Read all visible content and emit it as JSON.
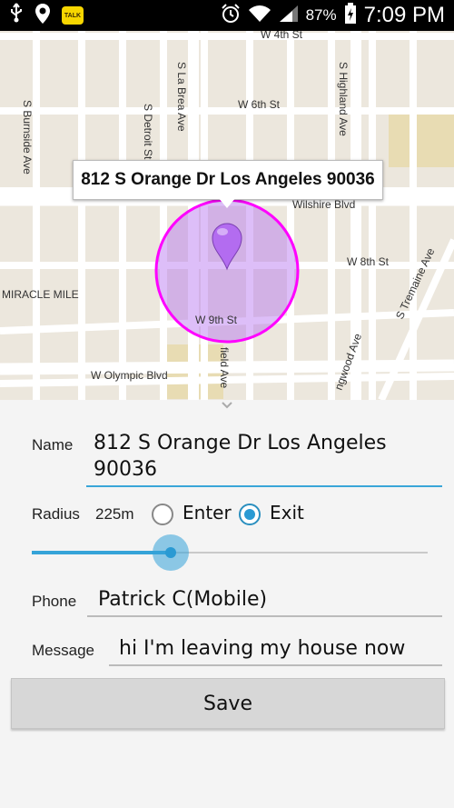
{
  "statusbar": {
    "icons": [
      "usb-icon",
      "location-icon",
      "kakaotalk-icon",
      "alarm-icon",
      "wifi-icon",
      "signal-icon",
      "battery-charging-icon"
    ],
    "talk_text": "TALK",
    "battery": "87%",
    "time": "7:09 PM"
  },
  "map": {
    "streets": {
      "w4th": "W 4th St",
      "w6th": "W 6th St",
      "wilshire": "Wilshire Blvd",
      "w8th": "W 8th St",
      "w9th": "W 9th St",
      "olympic": "W Olympic Blvd",
      "burnside": "S Burnside Ave",
      "detroit": "S Detroit St",
      "labrea": "S La Brea Ave",
      "highland": "S Highland Ave",
      "tremaine": "S Tremaine Ave",
      "longwood": "ngwood Ave",
      "fairfield": "field Ave",
      "miracle": "MIRACLE MILE"
    },
    "callout": "812 S Orange Dr Los Angeles 90036",
    "geofence_color": "#ff00ff",
    "marker_color": "#b36cf0"
  },
  "form": {
    "name_label": "Name",
    "name_value_line1": "812 S Orange Dr Los Angeles",
    "name_value_line2": "90036",
    "radius_label": "Radius",
    "radius_value": "225m",
    "radius_fraction": 0.35,
    "enter_label": "Enter",
    "exit_label": "Exit",
    "selected": "Exit",
    "phone_label": "Phone",
    "phone_value": "Patrick C(Mobile)",
    "message_label": "Message",
    "message_value": "hi I'm leaving my house now",
    "save_label": "Save",
    "accent_color": "#35a3d8"
  }
}
